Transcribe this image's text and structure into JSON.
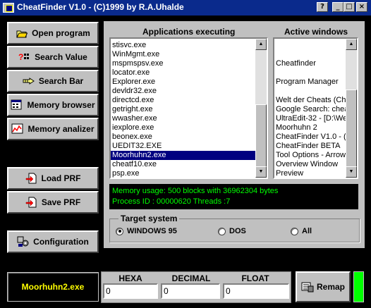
{
  "window": {
    "title": "CheatFinder V1.0 - (C)1999 by R.A.Uhalde",
    "controls": [
      "?",
      "_",
      "□",
      "×"
    ]
  },
  "sidebar": {
    "open_program": "Open program",
    "search_value": "Search Value",
    "search_bar": "Search Bar",
    "memory_browser": "Memory browser",
    "memory_analizer": "Memory analizer",
    "load_prf": "Load PRF",
    "save_prf": "Save PRF",
    "configuration": "Configuration"
  },
  "applications": {
    "title": "Applications executing",
    "items": [
      "stisvc.exe",
      "WinMgmt.exe",
      "mspmspsv.exe",
      "locator.exe",
      "Explorer.exe",
      "devldr32.exe",
      "directcd.exe",
      "getright.exe",
      "wwasher.exe",
      "iexplore.exe",
      "beonex.exe",
      "UEDIT32.EXE",
      "Moorhuhn2.exe",
      "cheatf10.exe",
      "psp.exe"
    ],
    "selected_index": 12
  },
  "windows": {
    "title": "Active windows",
    "items": [
      "",
      "",
      "Cheatfinder",
      "",
      "Program Manager",
      "",
      "Welt der Cheats (Che",
      "Google Search: chea",
      "UltraEdit-32 - [D:\\We",
      "Moorhuhn 2",
      "CheatFinder V1.0 - (C",
      "CheatFinder BETA",
      "Tool Options - Arrow",
      "Overview Window",
      "Preview"
    ]
  },
  "status": {
    "memory": "Memory usage: 500 blocks with 36962304 bytes",
    "process": "Process ID : 00000620  Threads :7"
  },
  "target": {
    "label": "Target system",
    "options": [
      "WINDOWS 95",
      "DOS",
      "All"
    ],
    "selected": "WINDOWS 95"
  },
  "bottom": {
    "selected_app": "Moorhuhn2.exe",
    "hexa_label": "HEXA",
    "decimal_label": "DECIMAL",
    "float_label": "FLOAT",
    "hexa_value": "0",
    "decimal_value": "0",
    "float_value": "0",
    "remap": "Remap"
  },
  "colors": {
    "title_bar": "#0a2a8c",
    "background": "#000000",
    "panel": "#c0c0c0",
    "selection": "#000080",
    "status_text": "#00ff00",
    "selected_app_text": "#ffff00",
    "indicator": "#00ff00"
  }
}
